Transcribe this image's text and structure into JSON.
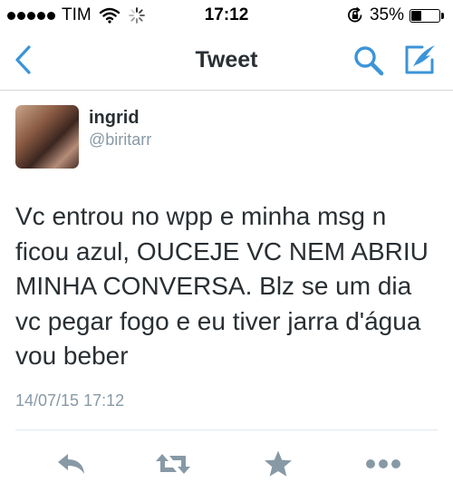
{
  "status_bar": {
    "carrier": "TIM",
    "time": "17:12",
    "battery_percent": "35%",
    "battery_level": 0.35,
    "signal_bars_filled": 5
  },
  "nav": {
    "title": "Tweet",
    "back_icon": "chevron-left-icon",
    "search_icon": "search-icon",
    "compose_icon": "compose-icon",
    "accent_color": "#3b94d9"
  },
  "tweet": {
    "author_name": "ingrid",
    "author_handle": "@biritarr",
    "text": "Vc entrou no wpp e minha msg n ficou azul, OUCEJE VC NEM ABRIU MINHA CONVERSA. Blz se um dia vc pegar fogo e eu tiver jarra d'água vou beber",
    "timestamp": "14/07/15 17:12"
  },
  "actions": {
    "icons": [
      "reply-icon",
      "retweet-icon",
      "favorite-icon",
      "more-icon"
    ],
    "icon_color": "#8899a6"
  }
}
